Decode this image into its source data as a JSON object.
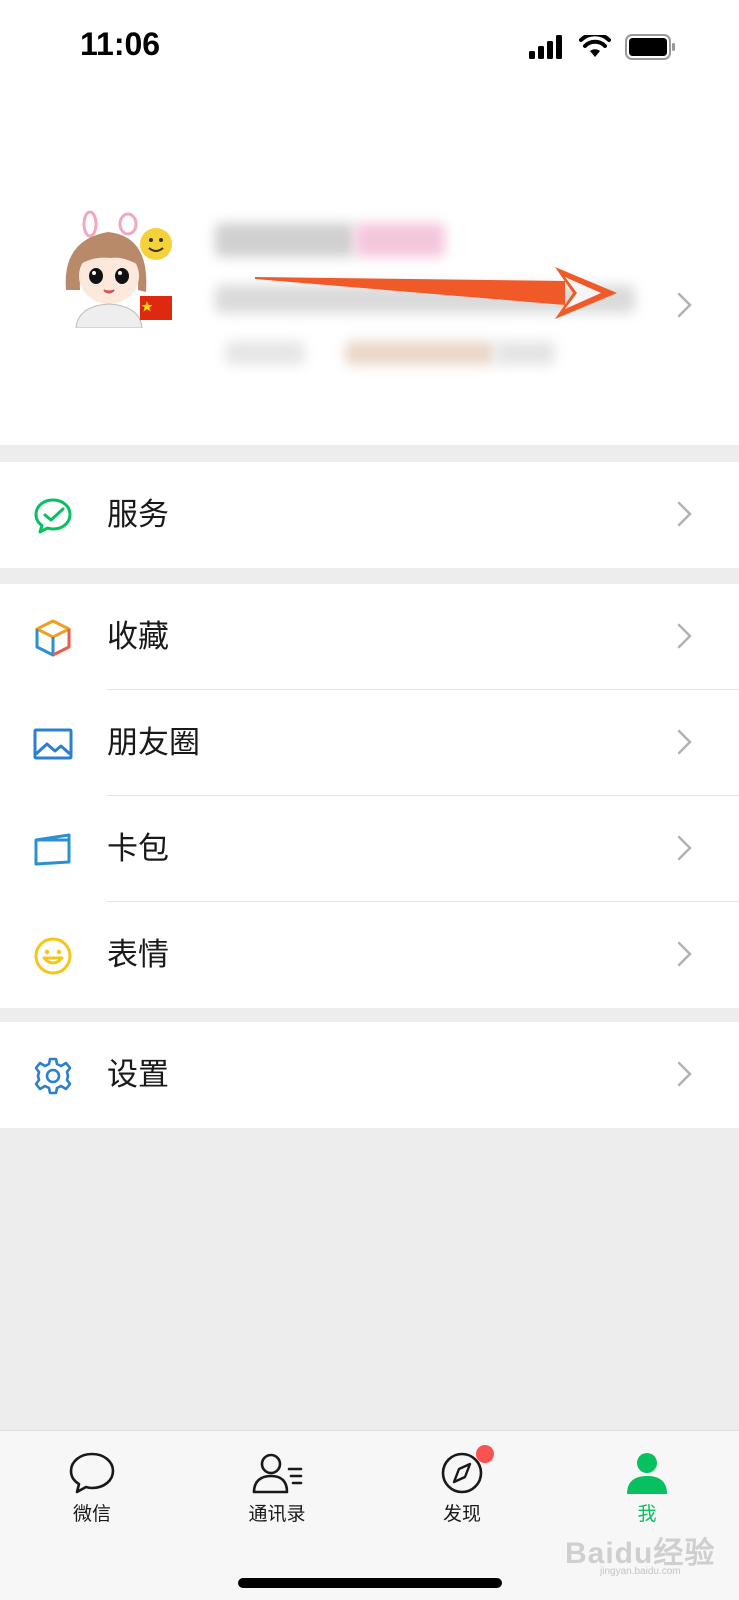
{
  "status_bar": {
    "time": "11:06"
  },
  "profile": {
    "avatar_description_icon": "cartoon-girl-avatar"
  },
  "menu": {
    "group1": [
      {
        "label": "服务",
        "icon": "service-check-bubble-icon",
        "icon_color": "#07c160"
      }
    ],
    "group2": [
      {
        "label": "收藏",
        "icon": "favorites-cube-icon",
        "icon_color": "#f0a020"
      },
      {
        "label": "朋友圈",
        "icon": "moments-picture-icon",
        "icon_color": "#2b7fd1"
      },
      {
        "label": "卡包",
        "icon": "card-wallet-icon",
        "icon_color": "#2b8fd1"
      },
      {
        "label": "表情",
        "icon": "sticker-smile-icon",
        "icon_color": "#f5c518"
      }
    ],
    "group3": [
      {
        "label": "设置",
        "icon": "settings-gear-icon",
        "icon_color": "#2b7fd1"
      }
    ]
  },
  "tab_bar": {
    "tabs": [
      {
        "label": "微信",
        "icon": "chat-bubble-icon"
      },
      {
        "label": "通讯录",
        "icon": "contacts-icon"
      },
      {
        "label": "发现",
        "icon": "compass-icon",
        "badge": true
      },
      {
        "label": "我",
        "icon": "me-person-icon",
        "active": true
      }
    ],
    "active_color": "#07c160"
  },
  "watermark": {
    "text": "Baidu经验",
    "sub": "jingyan.baidu.com"
  }
}
